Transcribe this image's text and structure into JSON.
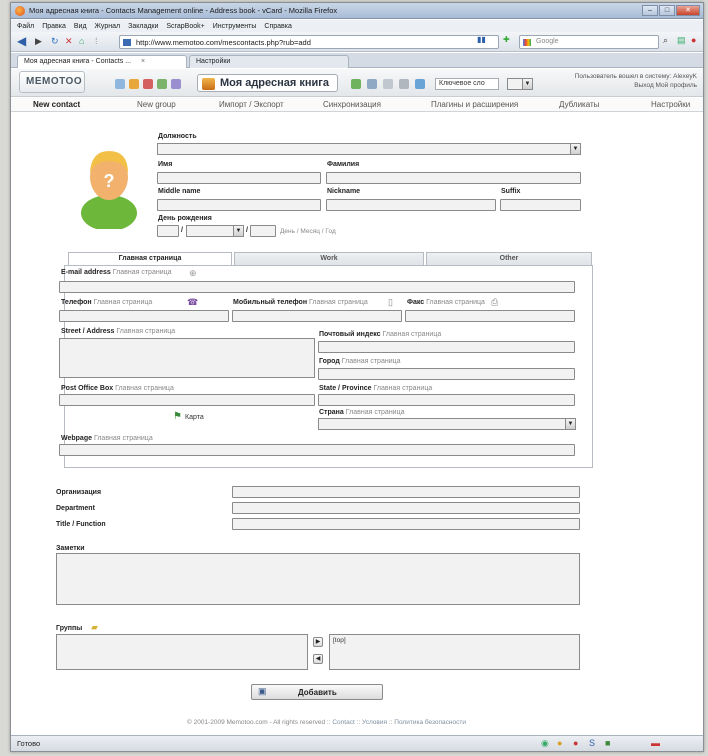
{
  "window": {
    "title": "Моя адресная книга - Contacts Management online - Address book - vCard - Mozilla Firefox",
    "status": "Готово"
  },
  "menu": [
    "Файл",
    "Правка",
    "Вид",
    "Журнал",
    "Закладки",
    "ScrapBook+",
    "Инструменты",
    "Справка"
  ],
  "browser": {
    "url": "http://www.memotoo.com/mescontacts.php?rub=add",
    "search_placeholder": "Google",
    "tabs": [
      {
        "label": "Моя адресная книга - Contacts ...",
        "close": "×"
      },
      {
        "label": "Настройки"
      }
    ]
  },
  "app": {
    "logo": "MEMOTOO",
    "title": "Моя адресная книга",
    "keyword_field": "Ключевое сло",
    "user_line1": "Пользователь вошел в систему: AlexeyK",
    "user_line2": "Выход  Мой профиль"
  },
  "subnav": {
    "new_contact": "New contact",
    "new_group": "New group",
    "import_export": "Импорт / Экспорт",
    "sync": "Синхронизация",
    "plugins": "Плагины и расширения",
    "duplicates": "Дубликаты",
    "settings": "Настройки"
  },
  "form": {
    "position": "Должность",
    "first_name": "Имя",
    "last_name": "Фамилия",
    "middle_name": "Middle name",
    "nickname": "Nickname",
    "suffix": "Suffix",
    "birthday": "День рождения",
    "birthday_sep": "/",
    "birthday_hint": "День / Месяц / Год",
    "tabs": [
      "Главная страница",
      "Work",
      "Other"
    ],
    "email": "E-mail address",
    "phone": "Телефон",
    "mobile": "Мобильный телефон",
    "fax": "Факс",
    "home_hint": "Главная страница",
    "street": "Street / Address",
    "postal_code": "Почтовый индекс",
    "city": "Город",
    "po_box": "Post Office Box",
    "state": "State / Province",
    "map": "Карта",
    "country": "Страна",
    "webpage": "Webpage",
    "organization": "Организация",
    "department": "Department",
    "title_function": "Title / Function",
    "notes": "Заметки",
    "groups": "Группы",
    "groups_selected": "[top]",
    "add_button": "Добавить"
  },
  "footer": {
    "copyright": "© 2001-2009 Memotoo.com - All rights reserved ::",
    "contact": "Contact",
    "sep": "::",
    "terms": "Условия",
    "privacy": "Политика безопасности"
  }
}
